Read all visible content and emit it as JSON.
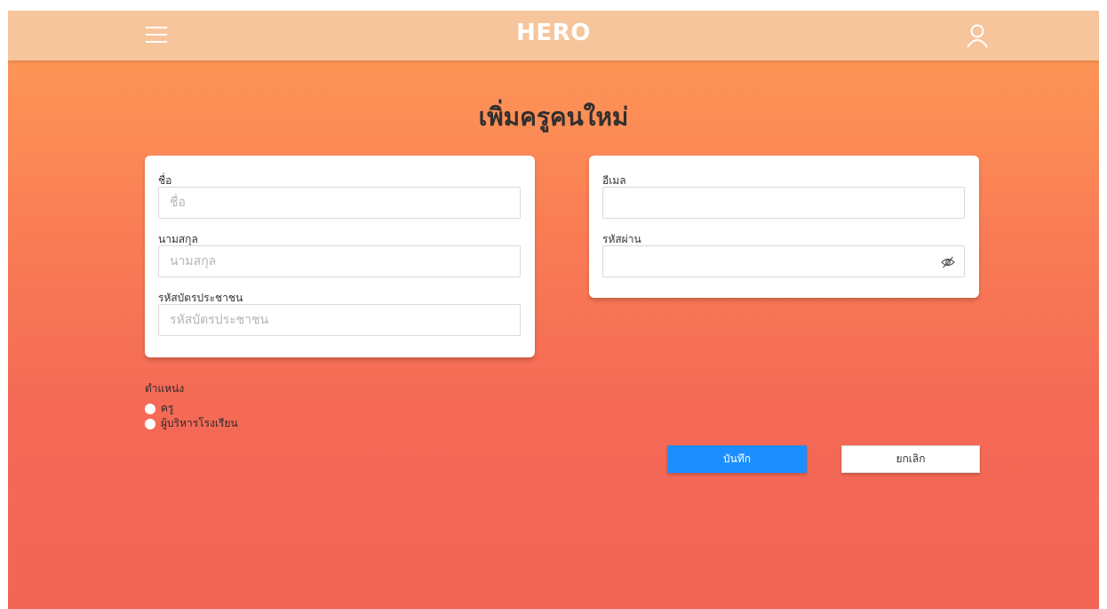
{
  "header": {
    "brand": "HERO",
    "menu_icon": "hamburger-menu-icon",
    "user_icon": "user-icon"
  },
  "page": {
    "title": "เพิ่มครูคนใหม่"
  },
  "form_left": {
    "first_name": {
      "label": "ชื่อ",
      "placeholder": "ชื่อ",
      "value": ""
    },
    "last_name": {
      "label": "นามสกุล",
      "placeholder": "นามสกุล",
      "value": ""
    },
    "national_id": {
      "label": "รหัสบัตรประชาชน",
      "placeholder": "รหัสบัตรประชาชน",
      "value": ""
    }
  },
  "form_right": {
    "email": {
      "label": "อีเมล",
      "placeholder": "",
      "value": ""
    },
    "password": {
      "label": "รหัสผ่าน",
      "placeholder": "",
      "value": "",
      "toggle_icon": "eye-off-icon"
    }
  },
  "position": {
    "label": "ตำแหน่ง",
    "options": [
      {
        "label": "ครู",
        "selected": false
      },
      {
        "label": "ผู้บริหารโรงเรียน",
        "selected": false
      }
    ]
  },
  "actions": {
    "save_label": "บันทึก",
    "cancel_label": "ยกเลิก"
  },
  "colors": {
    "header_bg": "#f7c59b",
    "gradient_top": "#fe9d56",
    "gradient_bottom": "#f26556",
    "save_button": "#1c8eff"
  }
}
